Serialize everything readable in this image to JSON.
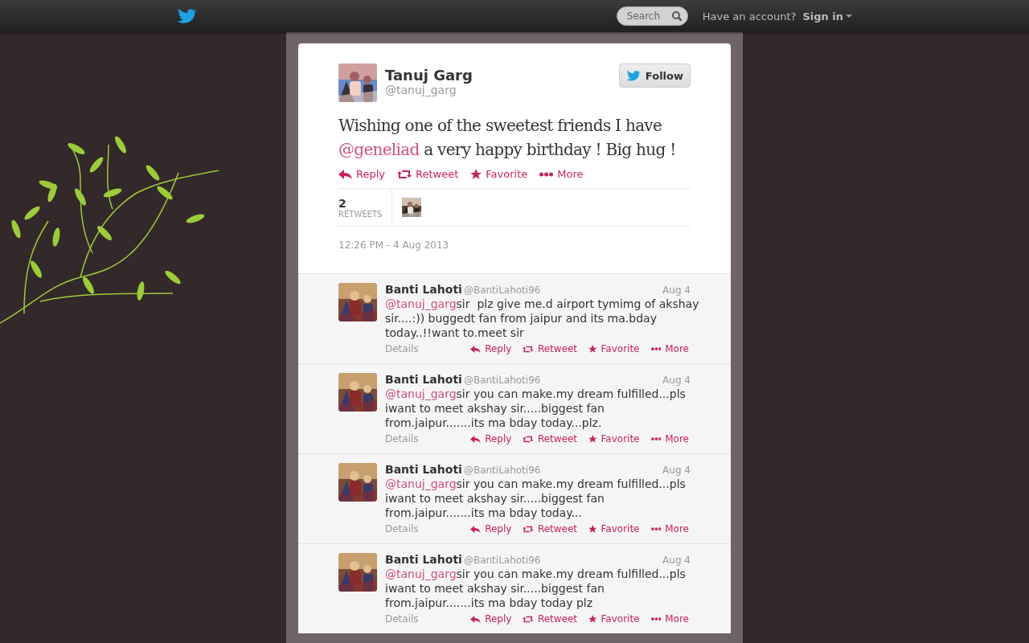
{
  "topbar": {
    "search": {
      "placeholder": "Search"
    },
    "account_prompt": "Have an account?",
    "sign_in": "Sign in"
  },
  "tweet": {
    "name": "Tanuj Garg",
    "handle": "@tanuj_garg",
    "follow_button": "Follow",
    "text": [
      {
        "kind": "text",
        "text": "Wishing one of the sweetest friends I have "
      },
      {
        "kind": "mention",
        "text": "@geneliad"
      },
      {
        "kind": "text",
        "text": " a very happy birthday ! Big hug !"
      }
    ],
    "actions": [
      {
        "kind": "reply",
        "label": "Reply"
      },
      {
        "kind": "retweet",
        "label": "Retweet"
      },
      {
        "kind": "favorite",
        "label": "Favorite"
      },
      {
        "kind": "more",
        "label": "More"
      }
    ],
    "retweets": {
      "count": "2",
      "label": "RETWEETS"
    },
    "timestamp": "12:26 PM - 4 Aug 2013"
  },
  "replies": [
    {
      "name": "Banti Lahoti",
      "handle": "@BantiLahoti96",
      "date": "Aug 4",
      "mention": "@tanuj_garg",
      "text": "sir  plz give me.d airport tymimg of akshay sir....:)) buggedt fan from jaipur and its ma.bday today..!!want to.meet sir",
      "details": "Details",
      "actions": [
        {
          "kind": "reply",
          "label": "Reply"
        },
        {
          "kind": "retweet",
          "label": "Retweet"
        },
        {
          "kind": "favorite",
          "label": "Favorite"
        },
        {
          "kind": "more",
          "label": "More"
        }
      ]
    },
    {
      "name": "Banti Lahoti",
      "handle": "@BantiLahoti96",
      "date": "Aug 4",
      "mention": "@tanuj_garg",
      "text": "sir you can make.my dream fulfilled...pls iwant to meet akshay sir.....biggest fan from.jaipur.......its ma bday today...plz.",
      "details": "Details",
      "actions": [
        {
          "kind": "reply",
          "label": "Reply"
        },
        {
          "kind": "retweet",
          "label": "Retweet"
        },
        {
          "kind": "favorite",
          "label": "Favorite"
        },
        {
          "kind": "more",
          "label": "More"
        }
      ]
    },
    {
      "name": "Banti Lahoti",
      "handle": "@BantiLahoti96",
      "date": "Aug 4",
      "mention": "@tanuj_garg",
      "text": "sir you can make.my dream fulfilled...pls iwant to meet akshay sir.....biggest fan from.jaipur.......its ma bday today...",
      "details": "Details",
      "actions": [
        {
          "kind": "reply",
          "label": "Reply"
        },
        {
          "kind": "retweet",
          "label": "Retweet"
        },
        {
          "kind": "favorite",
          "label": "Favorite"
        },
        {
          "kind": "more",
          "label": "More"
        }
      ]
    },
    {
      "name": "Banti Lahoti",
      "handle": "@BantiLahoti96",
      "date": "Aug 4",
      "mention": "@tanuj_garg",
      "text": "sir you can make.my dream fulfilled...pls iwant to meet akshay sir.....biggest fan from.jaipur.......its ma bday today plz",
      "details": "Details",
      "actions": [
        {
          "kind": "reply",
          "label": "Reply"
        },
        {
          "kind": "retweet",
          "label": "Retweet"
        },
        {
          "kind": "favorite",
          "label": "Favorite"
        },
        {
          "kind": "more",
          "label": "More"
        }
      ]
    }
  ]
}
